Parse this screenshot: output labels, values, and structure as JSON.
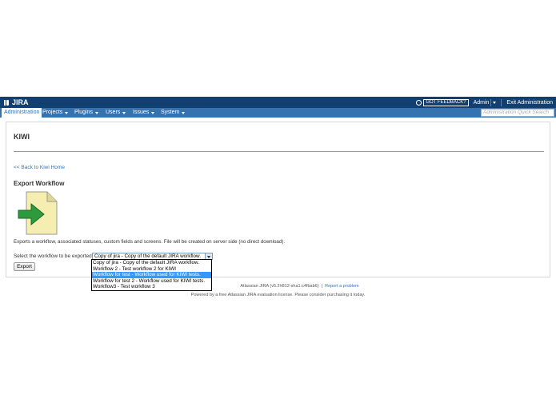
{
  "header": {
    "logo_text": "JIRA",
    "feedback_label": "GOT FEEDBACK?",
    "user_label": "Admin",
    "exit_label": "Exit Administration"
  },
  "nav": {
    "items": [
      {
        "label": "Administration"
      },
      {
        "label": "Projects"
      },
      {
        "label": "Plugins"
      },
      {
        "label": "Users"
      },
      {
        "label": "Issues"
      },
      {
        "label": "System"
      }
    ],
    "quick_search_placeholder": "Administration Quick Search"
  },
  "main": {
    "title": "KIWI",
    "back_link": "<< Back to Kiwi Home",
    "section_title": "Export Workflow",
    "description": "Exports a workflow, associated statuses, custom fields and screens. File will be created on server side (no direct download).",
    "select_label": "Select the workflow to be exported",
    "select_value": "Copy of jira - Copy of the default JIRA workflow.",
    "export_button": "Export"
  },
  "dropdown": {
    "options": [
      "Copy of jira - Copy of the default JIRA workflow.",
      "Workflow 2 - Test workflow 2 for KIWI",
      "Workflow for test - Workflow used for KIWI tests.",
      "Workflow for test 2 - Workflow used for KIWI tests.",
      "Workflow3 - Test workflow 3"
    ],
    "highlighted_index": 2
  },
  "footer": {
    "version_text": "Atlassian JIRA (v5.2#812-sha1:c4fbab6)",
    "separator": "|",
    "report_link": "Report a problem",
    "license_text": "Powered by a free Atlassian JIRA evaluation license. Please consider purchasing it today."
  },
  "colors": {
    "header_bg": "#114070",
    "nav_bg": "#3572b0",
    "link": "#3572b0",
    "selected_option": "#3399ff"
  }
}
